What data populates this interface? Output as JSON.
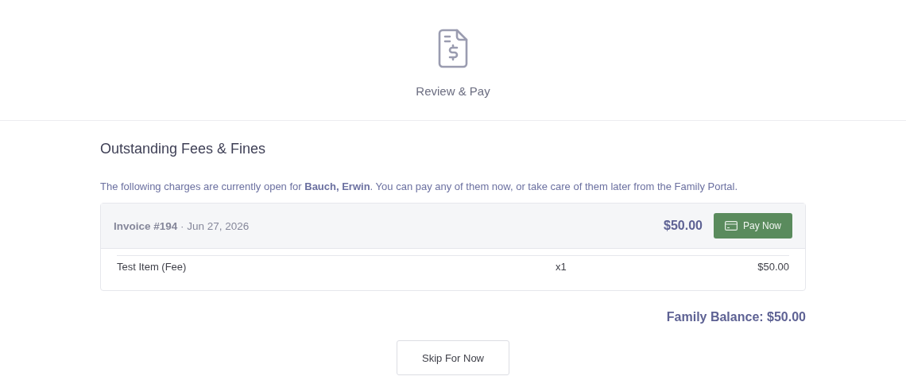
{
  "header": {
    "title": "Review & Pay"
  },
  "section_title": "Outstanding Fees & Fines",
  "intro": "The following charges are currently open for **Bauch, Erwin**. You can pay any of them now, or take care of them later from the Family Portal.",
  "invoices": [
    {
      "heading": "**Invoice #194** · Jun 27, 2026",
      "total": "$50.00",
      "pay_button": "Pay Now",
      "items": [
        {
          "name": "Test Item (Fee)",
          "quantity": "x1",
          "amount": "$50.00"
        }
      ]
    }
  ],
  "family_balance": "Family Balance: $50.00",
  "skip_button": "Skip For Now"
}
